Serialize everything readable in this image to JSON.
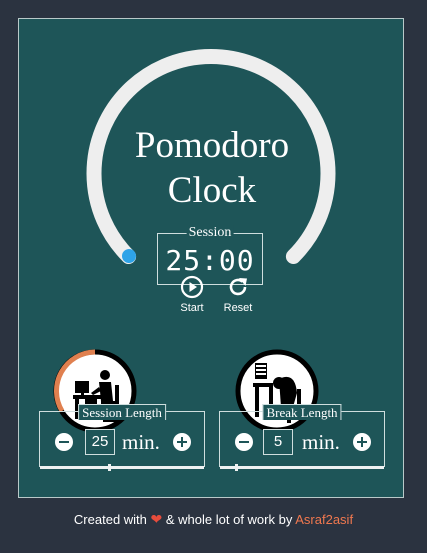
{
  "app": {
    "title_line1": "Pomodoro",
    "title_line2": "Clock"
  },
  "timer": {
    "legend": "Session",
    "display": "25:00",
    "progress_fraction": 0.0
  },
  "controls": {
    "start_label": "Start",
    "reset_label": "Reset"
  },
  "session_length": {
    "legend": "Session Length",
    "value": "25",
    "unit": "min."
  },
  "break_length": {
    "legend": "Break Length",
    "value": "5",
    "unit": "min."
  },
  "footer": {
    "prefix": "Created with",
    "middle": "& whole lot of work by",
    "author": "Asraf2asif"
  },
  "colors": {
    "background": "#2b3340",
    "panel": "#1e5558",
    "ring": "#eeeeee",
    "ring_dot": "#2ea3e8",
    "avatar_accent": "#e0804f",
    "heart": "#e74c3c",
    "author": "#f0784f"
  },
  "icons": {
    "start": "play-circle-icon",
    "reset": "redo-icon",
    "minus": "minus-circle-icon",
    "plus": "plus-circle-icon",
    "heart": "heart-icon"
  }
}
